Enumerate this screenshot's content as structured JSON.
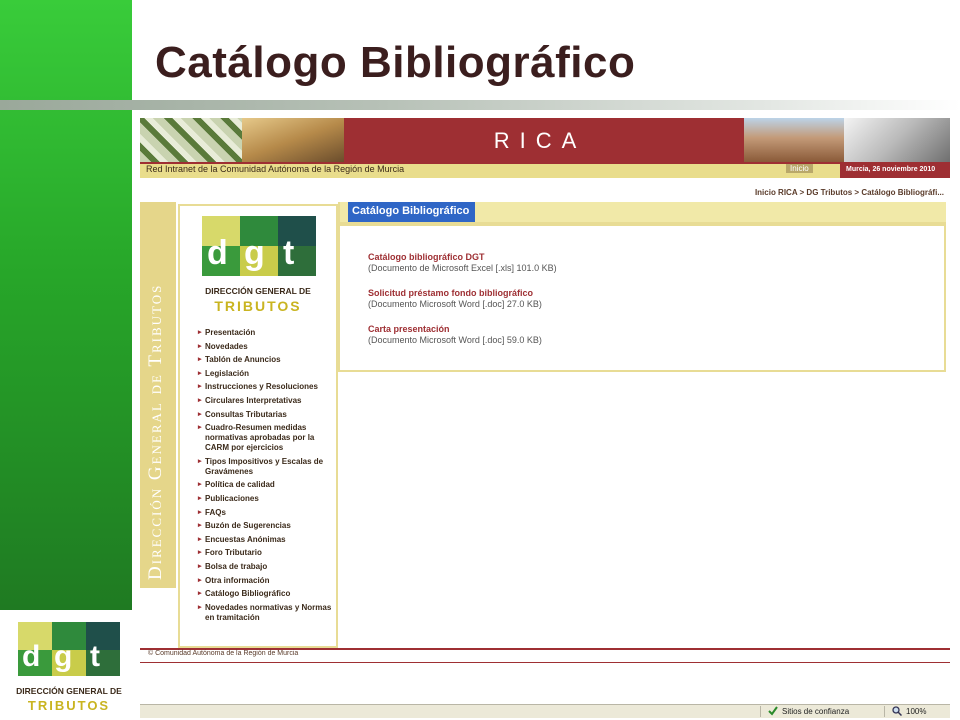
{
  "slide": {
    "title": "Catálogo Bibliográfico",
    "logo_line1": "DIRECCIÓN GENERAL DE",
    "logo_line2": "TRIBUTOS"
  },
  "site": {
    "banner_brand": "RICA",
    "network_name": "Red Intranet de la Comunidad Autónoma de la Región de Murcia",
    "inicio_label": "Inicio",
    "date": "Murcia, 26 noviembre 2010",
    "breadcrumb": "Inicio RICA > DG Tributos > Catálogo Bibliográfi...",
    "vertical_label": "Dirección General de Tributos",
    "logo_line1": "DIRECCIÓN GENERAL DE",
    "logo_line2": "TRIBUTOS",
    "nav": [
      "Presentación",
      "Novedades",
      "Tablón de Anuncios",
      "Legislación",
      "Instrucciones y Resoluciones",
      "Circulares Interpretativas",
      "Consultas Tributarias",
      "Cuadro-Resumen medidas normativas aprobadas por la CARM por ejercicios",
      "Tipos Impositivos y Escalas de Gravámenes",
      "Política de calidad",
      "Publicaciones",
      "FAQs",
      "Buzón de Sugerencias",
      "Encuestas Anónimas",
      "Foro Tributario",
      "Bolsa de trabajo",
      "Otra información",
      "Catálogo Bibliográfico",
      "Novedades normativas y Normas en tramitación"
    ],
    "section_tab": "Catálogo Bibliográfico",
    "documents": [
      {
        "title": "Catálogo bibliográfico DGT",
        "desc": "(Documento de Microsoft Excel [.xls] 101.0 KB)"
      },
      {
        "title": "Solicitud préstamo fondo bibliográfico",
        "desc": "(Documento Microsoft Word [.doc] 27.0 KB)"
      },
      {
        "title": "Carta presentación",
        "desc": "(Documento Microsoft Word [.doc] 59.0 KB)"
      }
    ],
    "copyright": "© Comunidad Autónoma de la Región de Murcia"
  },
  "statusbar": {
    "trusted_sites": "Sitios de confianza",
    "zoom": "100%"
  },
  "colors": {
    "green": "#2fb530",
    "maroon": "#9e2f33",
    "sand": "#e9dd8c",
    "tab_blue": "#2f66c6"
  },
  "icons": [
    "dgt-logo",
    "trusted-check-icon",
    "zoom-magnifier-icon",
    "nav-arrow-icon"
  ]
}
